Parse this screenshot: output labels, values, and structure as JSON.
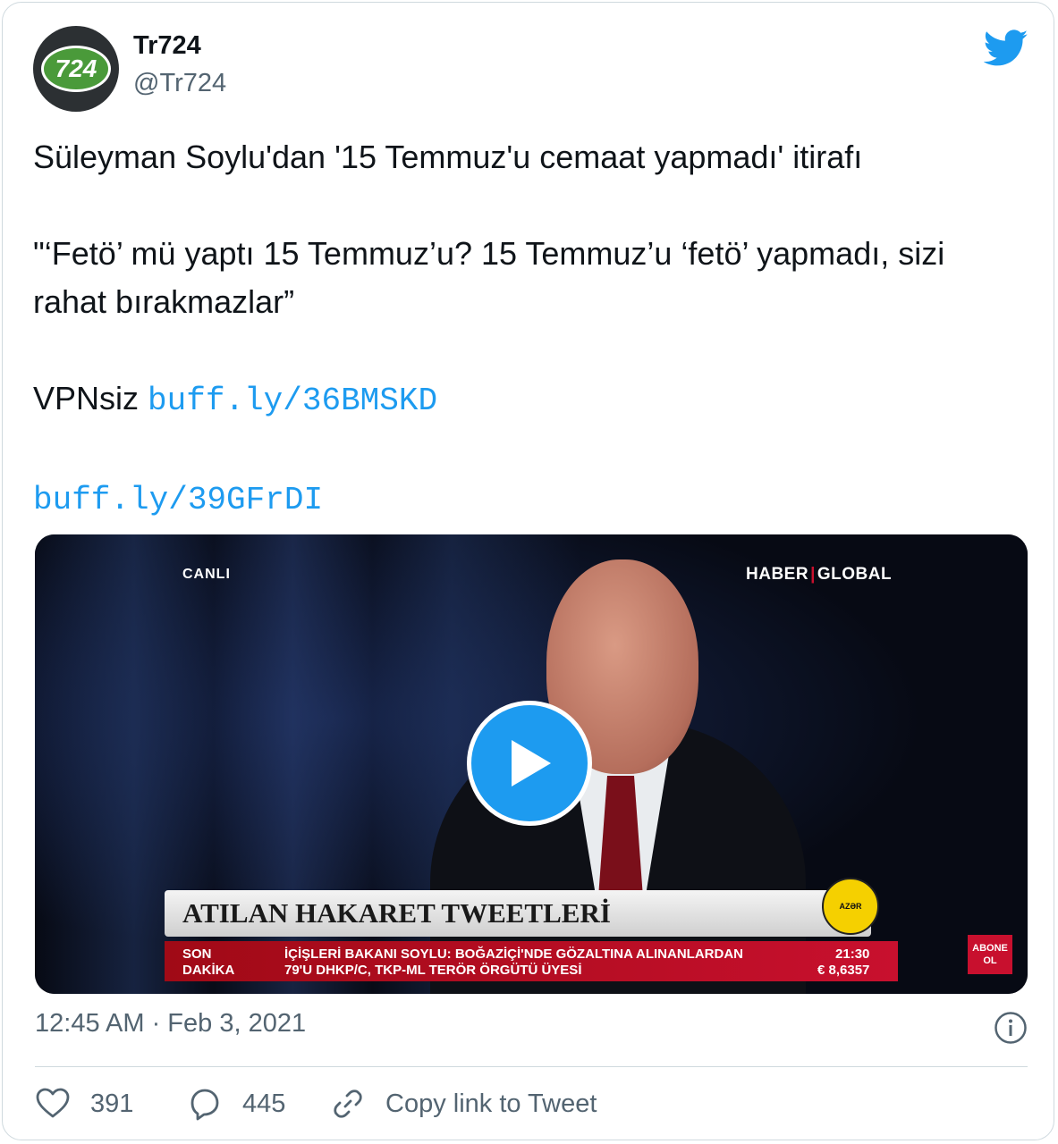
{
  "user": {
    "name": "Tr724",
    "handle": "@Tr724",
    "avatar_text": "724"
  },
  "tweet": {
    "line1": "Süleyman Soylu'dan '15 Temmuz'u cemaat yapmadı' itirafı",
    "line2": "\"‘Fetö’ mü yaptı 15 Temmuz’u? 15 Temmuz’u ‘fetö’ yapmadı, sizi rahat bırakmazlar”",
    "vpn_label": "VPNsiz ",
    "link1": "buff.ly/36BMSKD",
    "link2": "buff.ly/39GFrDI"
  },
  "video": {
    "live_label": "CANLI",
    "channel_left": "HABER",
    "channel_right": "GLOBAL",
    "banner": "ATILAN HAKARET TWEETLERİ",
    "host_badge": "AZƏR",
    "ticker_left_1": "SON",
    "ticker_left_2": "DAKİKA",
    "ticker_news_1": "İÇİŞLERİ BAKANI SOYLU: BOĞAZİÇİ'NDE GÖZALTINA ALINANLARDAN",
    "ticker_news_2": "79'U DHKP/C, TKP-ML TERÖR ÖRGÜTÜ ÜYESİ",
    "ticker_time": "21:30",
    "ticker_rate": "€ 8,6357",
    "abone_1": "ABONE",
    "abone_2": "OL"
  },
  "meta": {
    "timestamp": "12:45 AM · Feb 3, 2021"
  },
  "actions": {
    "likes": "391",
    "replies": "445",
    "copy_link": "Copy link to Tweet"
  },
  "colors": {
    "twitter_blue": "#1d9bf0",
    "text_secondary": "#536471",
    "border": "#cfd9de"
  }
}
